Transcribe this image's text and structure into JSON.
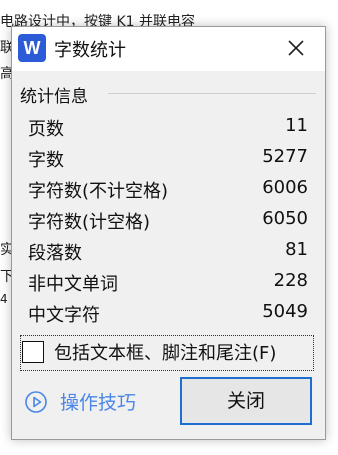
{
  "background_doc": {
    "lines": [
      "",
      "电路设计中，按键 K1 并联电容",
      "联",
      "高",
      "实",
      "下",
      "4"
    ]
  },
  "dialog": {
    "title": "字数统计",
    "app_icon_letter": "W",
    "group_title": "统计信息",
    "stats": [
      {
        "label": "页数",
        "value": "11"
      },
      {
        "label": "字数",
        "value": "5277"
      },
      {
        "label": "字符数(不计空格)",
        "value": "6006"
      },
      {
        "label": "字符数(计空格)",
        "value": "6050"
      },
      {
        "label": "段落数",
        "value": "81"
      },
      {
        "label": "非中文单词",
        "value": "228"
      },
      {
        "label": "中文字符",
        "value": "5049"
      }
    ],
    "checkbox_label": "包括文本框、脚注和尾注(F)",
    "checkbox_checked": false,
    "tips_label": "操作技巧",
    "close_button_label": "关闭"
  },
  "colors": {
    "accent": "#1e6fd0",
    "icon_blue": "#2b5bd6",
    "link_blue": "#4a86e8"
  }
}
